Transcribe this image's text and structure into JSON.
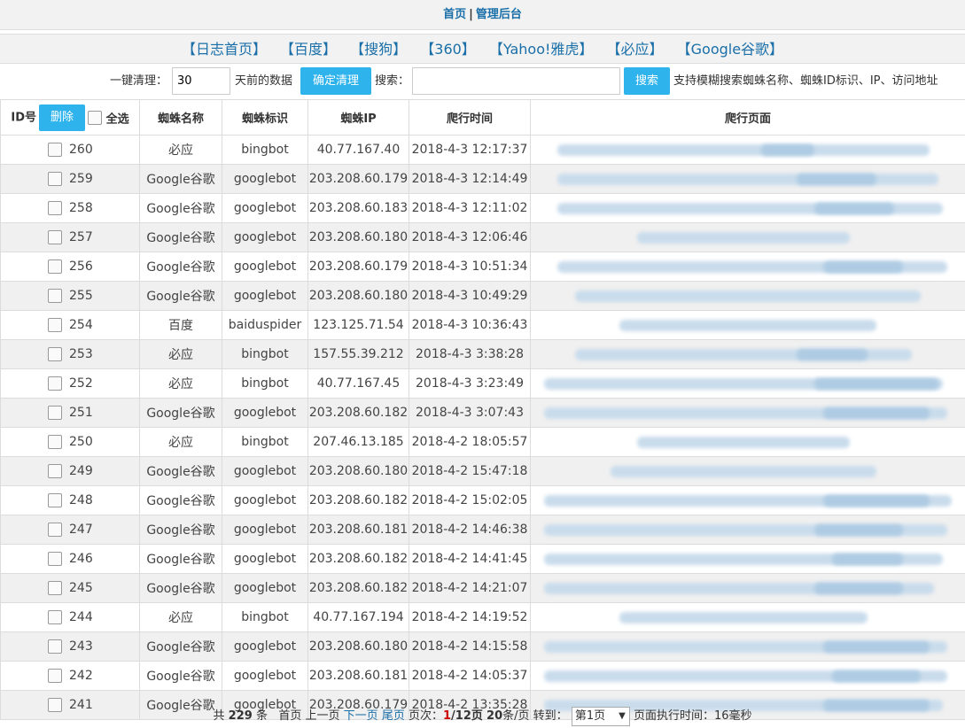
{
  "topnav": {
    "home": "首页",
    "sep": "|",
    "admin": "管理后台"
  },
  "engines": [
    "【日志首页】",
    "【百度】",
    "【搜狗】",
    "【360】",
    "【Yahoo!雅虎】",
    "【必应】",
    "【Google谷歌】"
  ],
  "toolbar": {
    "clean_label": "一键清理：",
    "days_value": "30",
    "days_suffix": "天前的数据",
    "clean_button": "确定清理",
    "search_label": "搜索：",
    "search_value": "",
    "search_button": "搜索",
    "search_hint": "支持模糊搜索蜘蛛名称、蜘蛛ID标识、IP、访问地址"
  },
  "table": {
    "headers": {
      "id": "ID号",
      "delete": "删除",
      "select_all": "全选",
      "name": "蜘蛛名称",
      "ident": "蜘蛛标识",
      "ip": "蜘蛛IP",
      "time": "爬行时间",
      "page": "爬行页面"
    },
    "rows": [
      {
        "id": "260",
        "name": "必应",
        "ident": "bingbot",
        "ip": "40.77.167.40",
        "time": "2018-4-3 12:17:37"
      },
      {
        "id": "259",
        "name": "Google谷歌",
        "ident": "googlebot",
        "ip": "203.208.60.179",
        "time": "2018-4-3 12:14:49"
      },
      {
        "id": "258",
        "name": "Google谷歌",
        "ident": "googlebot",
        "ip": "203.208.60.183",
        "time": "2018-4-3 12:11:02"
      },
      {
        "id": "257",
        "name": "Google谷歌",
        "ident": "googlebot",
        "ip": "203.208.60.180",
        "time": "2018-4-3 12:06:46"
      },
      {
        "id": "256",
        "name": "Google谷歌",
        "ident": "googlebot",
        "ip": "203.208.60.179",
        "time": "2018-4-3 10:51:34"
      },
      {
        "id": "255",
        "name": "Google谷歌",
        "ident": "googlebot",
        "ip": "203.208.60.180",
        "time": "2018-4-3 10:49:29"
      },
      {
        "id": "254",
        "name": "百度",
        "ident": "baiduspider",
        "ip": "123.125.71.54",
        "time": "2018-4-3 10:36:43"
      },
      {
        "id": "253",
        "name": "必应",
        "ident": "bingbot",
        "ip": "157.55.39.212",
        "time": "2018-4-3 3:38:28"
      },
      {
        "id": "252",
        "name": "必应",
        "ident": "bingbot",
        "ip": "40.77.167.45",
        "time": "2018-4-3 3:23:49"
      },
      {
        "id": "251",
        "name": "Google谷歌",
        "ident": "googlebot",
        "ip": "203.208.60.182",
        "time": "2018-4-3 3:07:43"
      },
      {
        "id": "250",
        "name": "必应",
        "ident": "bingbot",
        "ip": "207.46.13.185",
        "time": "2018-4-2 18:05:57"
      },
      {
        "id": "249",
        "name": "Google谷歌",
        "ident": "googlebot",
        "ip": "203.208.60.180",
        "time": "2018-4-2 15:47:18"
      },
      {
        "id": "248",
        "name": "Google谷歌",
        "ident": "googlebot",
        "ip": "203.208.60.182",
        "time": "2018-4-2 15:02:05"
      },
      {
        "id": "247",
        "name": "Google谷歌",
        "ident": "googlebot",
        "ip": "203.208.60.181",
        "time": "2018-4-2 14:46:38"
      },
      {
        "id": "246",
        "name": "Google谷歌",
        "ident": "googlebot",
        "ip": "203.208.60.182",
        "time": "2018-4-2 14:41:45"
      },
      {
        "id": "245",
        "name": "Google谷歌",
        "ident": "googlebot",
        "ip": "203.208.60.182",
        "time": "2018-4-2 14:21:07"
      },
      {
        "id": "244",
        "name": "必应",
        "ident": "bingbot",
        "ip": "40.77.167.194",
        "time": "2018-4-2 14:19:52"
      },
      {
        "id": "243",
        "name": "Google谷歌",
        "ident": "googlebot",
        "ip": "203.208.60.180",
        "time": "2018-4-2 14:15:58"
      },
      {
        "id": "242",
        "name": "Google谷歌",
        "ident": "googlebot",
        "ip": "203.208.60.181",
        "time": "2018-4-2 14:05:37"
      },
      {
        "id": "241",
        "name": "Google谷歌",
        "ident": "googlebot",
        "ip": "203.208.60.179",
        "time": "2018-4-2 13:35:28"
      }
    ]
  },
  "pager": {
    "total_prefix": "共",
    "total": "229",
    "total_suffix": "条",
    "first": "首页",
    "prev": "上一页",
    "next": "下一页",
    "last": "尾页",
    "page_label": "页次：",
    "current": "1",
    "pages": "/12页",
    "per_page": "20",
    "per_page_suffix": "条/页",
    "goto": "转到：",
    "select_value": "第1页",
    "exec_time": "页面执行时间：16毫秒"
  },
  "colors": {
    "accent": "#2eb3ec",
    "link": "#1a6fa8",
    "alert": "#cc0000",
    "row_alt": "#f0f0f0"
  },
  "icons": {
    "checkbox": "checkbox-icon",
    "dropdown": "chevron-down-icon"
  }
}
